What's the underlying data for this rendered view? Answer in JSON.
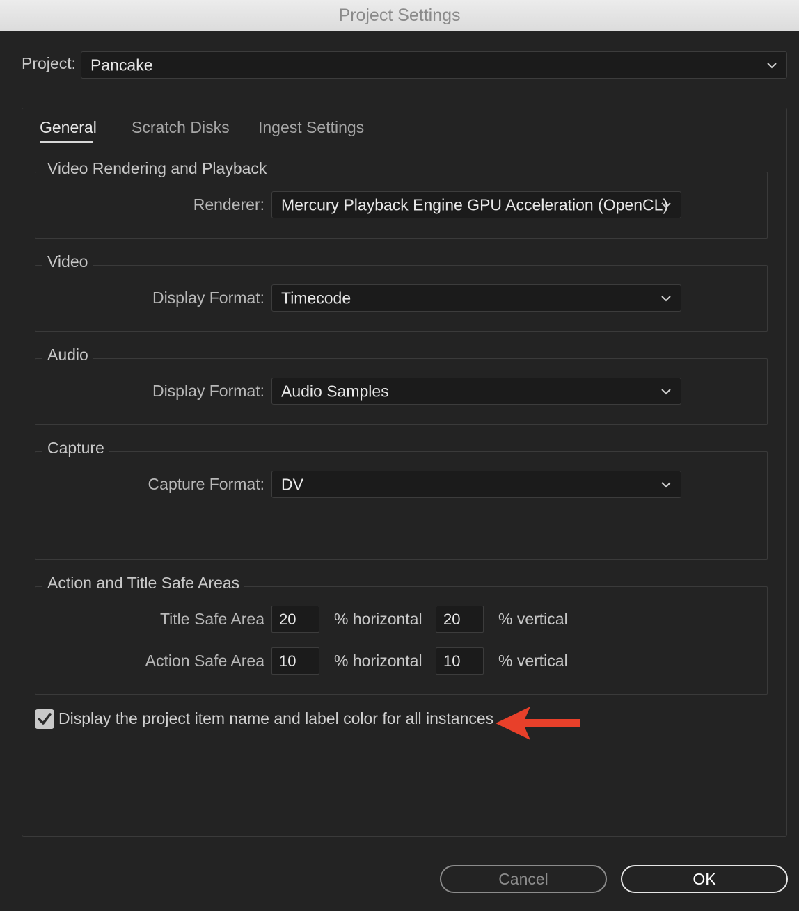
{
  "window": {
    "title": "Project Settings"
  },
  "project": {
    "label": "Project:",
    "value": "Pancake"
  },
  "tabs": [
    {
      "label": "General",
      "active": true
    },
    {
      "label": "Scratch Disks",
      "active": false
    },
    {
      "label": "Ingest Settings",
      "active": false
    }
  ],
  "sections": {
    "video_rendering": {
      "legend": "Video Rendering and Playback",
      "renderer_label": "Renderer:",
      "renderer_value": "Mercury Playback Engine GPU Acceleration (OpenCL)"
    },
    "video": {
      "legend": "Video",
      "display_format_label": "Display Format:",
      "display_format_value": "Timecode"
    },
    "audio": {
      "legend": "Audio",
      "display_format_label": "Display Format:",
      "display_format_value": "Audio Samples"
    },
    "capture": {
      "legend": "Capture",
      "capture_format_label": "Capture Format:",
      "capture_format_value": "DV"
    },
    "safe_areas": {
      "legend": "Action and Title Safe Areas",
      "title_safe_label": "Title Safe Area",
      "title_safe_horizontal": "20",
      "title_safe_vertical": "20",
      "action_safe_label": "Action Safe Area",
      "action_safe_horizontal": "10",
      "action_safe_vertical": "10",
      "horizontal_unit": "% horizontal",
      "vertical_unit": "% vertical"
    }
  },
  "display_item_name_checkbox": {
    "label": "Display the project item name and label color for all instances",
    "checked": true
  },
  "annotation": {
    "icon": "red-arrow-icon",
    "color": "#e8402a"
  },
  "buttons": {
    "cancel": "Cancel",
    "ok": "OK"
  }
}
